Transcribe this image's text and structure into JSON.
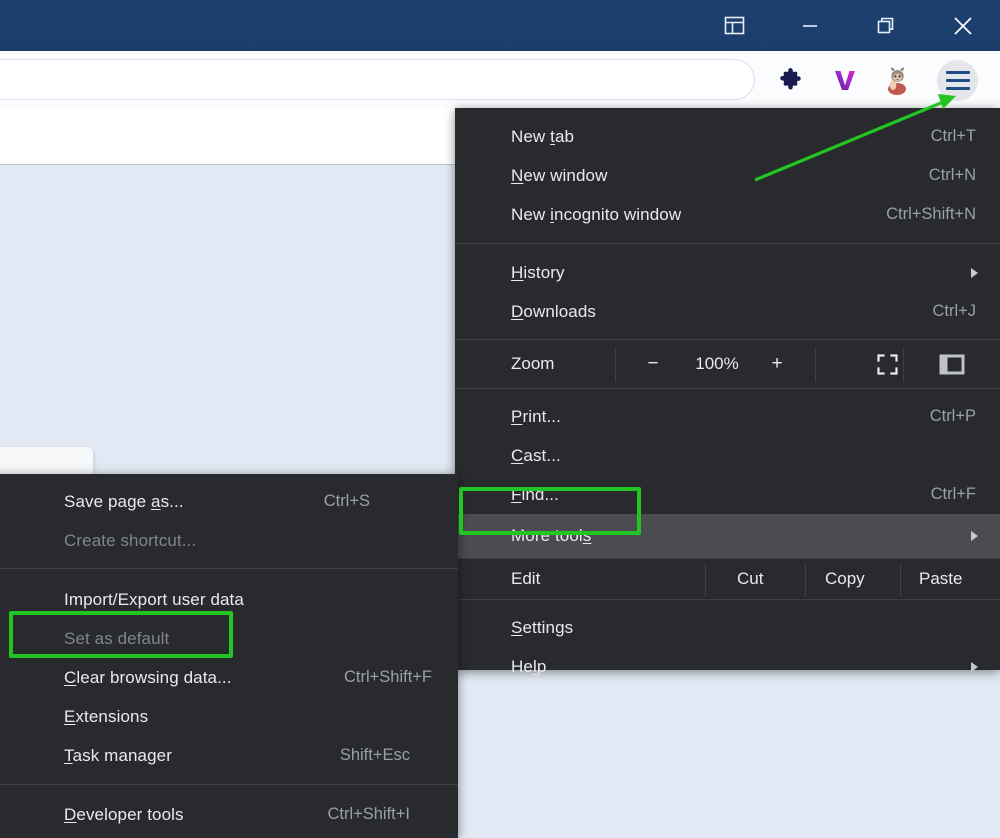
{
  "window": {
    "titlebar_buttons": [
      {
        "name": "panel-layout",
        "icon": "panel-layout-icon"
      },
      {
        "name": "minimize",
        "icon": "minimize-icon"
      },
      {
        "name": "restore",
        "icon": "restore-icon"
      },
      {
        "name": "close",
        "icon": "close-icon"
      }
    ]
  },
  "toolbar": {
    "address_bar_value": "",
    "address_bar_placeholder": "",
    "icons": [
      {
        "name": "extensions-puzzle-icon",
        "label": "Extensions"
      },
      {
        "name": "vivaldi-v-icon",
        "label": "V"
      },
      {
        "name": "profile-avatar-icon",
        "label": "Profile"
      },
      {
        "name": "main-menu-hamburger-icon",
        "label": "Customize and control"
      }
    ]
  },
  "main_menu": {
    "groups": [
      {
        "items": [
          {
            "label": "New tab",
            "accel": "Ctrl+T",
            "mnemonic_index": 4,
            "disabled": false,
            "submenu": false
          },
          {
            "label": "New window",
            "accel": "Ctrl+N",
            "mnemonic_index": 0,
            "disabled": false,
            "submenu": false
          },
          {
            "label": "New incognito window",
            "accel": "Ctrl+Shift+N",
            "mnemonic_index": 4,
            "disabled": false,
            "submenu": false
          }
        ]
      },
      {
        "items": [
          {
            "label": "History",
            "accel": "",
            "mnemonic_index": 0,
            "disabled": false,
            "submenu": true
          },
          {
            "label": "Downloads",
            "accel": "Ctrl+J",
            "mnemonic_index": 0,
            "disabled": false,
            "submenu": false
          }
        ]
      }
    ],
    "zoom_row": {
      "label": "Zoom",
      "minus": "−",
      "level": "100%",
      "plus": "+",
      "fullscreen_icon": "fullscreen-icon",
      "panel_icon": "side-panel-icon"
    },
    "group3": [
      {
        "label": "Print...",
        "accel": "Ctrl+P",
        "mnemonic_index": 0,
        "disabled": false,
        "submenu": false
      },
      {
        "label": "Cast...",
        "accel": "",
        "mnemonic_index": 0,
        "disabled": false,
        "submenu": false
      },
      {
        "label": "Find...",
        "accel": "Ctrl+F",
        "mnemonic_index": 0,
        "disabled": false,
        "submenu": false
      },
      {
        "label": "More tools",
        "accel": "",
        "mnemonic_index": 8,
        "disabled": false,
        "submenu": true,
        "highlighted": true
      }
    ],
    "edit_row": {
      "label": "Edit",
      "cut": "Cut",
      "copy": "Copy",
      "paste": "Paste"
    },
    "group4": [
      {
        "label": "Settings",
        "accel": "",
        "mnemonic_index": 0,
        "disabled": false,
        "submenu": false
      },
      {
        "label": "Help",
        "accel": "",
        "mnemonic_index": 2,
        "disabled": false,
        "submenu": true
      }
    ]
  },
  "more_tools_submenu": {
    "groups": [
      {
        "items": [
          {
            "label": "Save page as...",
            "accel": "Ctrl+S",
            "mnemonic_index": 10,
            "disabled": false
          },
          {
            "label": "Create shortcut...",
            "accel": "",
            "mnemonic_index": -1,
            "disabled": true
          }
        ]
      },
      {
        "items": [
          {
            "label": "Import/Export user data",
            "accel": "",
            "mnemonic_index": -1,
            "disabled": false
          },
          {
            "label": "Set as default",
            "accel": "",
            "mnemonic_index": -1,
            "disabled": true,
            "highlighted_box": true
          },
          {
            "label": "Clear browsing data...",
            "accel": "Ctrl+Shift+F",
            "mnemonic_index": 0,
            "disabled": false
          },
          {
            "label": "Extensions",
            "accel": "",
            "mnemonic_index": 0,
            "disabled": false
          },
          {
            "label": "Task manager",
            "accel": "Shift+Esc",
            "mnemonic_index": 0,
            "disabled": false
          }
        ]
      },
      {
        "items": [
          {
            "label": "Developer tools",
            "accel": "Ctrl+Shift+I",
            "mnemonic_index": 0,
            "disabled": false
          }
        ]
      }
    ]
  },
  "annotations": {
    "highlight_color": "#22c522",
    "boxes": [
      {
        "name": "more-tools-highlight-box",
        "target": "More tools"
      },
      {
        "name": "set-as-default-highlight-box",
        "target": "Set as default"
      }
    ],
    "arrow": {
      "name": "pointer-arrow",
      "target": "main-menu-hamburger-icon",
      "color": "#22c522"
    }
  },
  "colors": {
    "titlebar": "#1d3f6d",
    "menu_bg": "#292a2d",
    "menu_highlight": "#4a4c50",
    "page_bg": "#e2e9f4",
    "accent_green": "#22c522"
  }
}
